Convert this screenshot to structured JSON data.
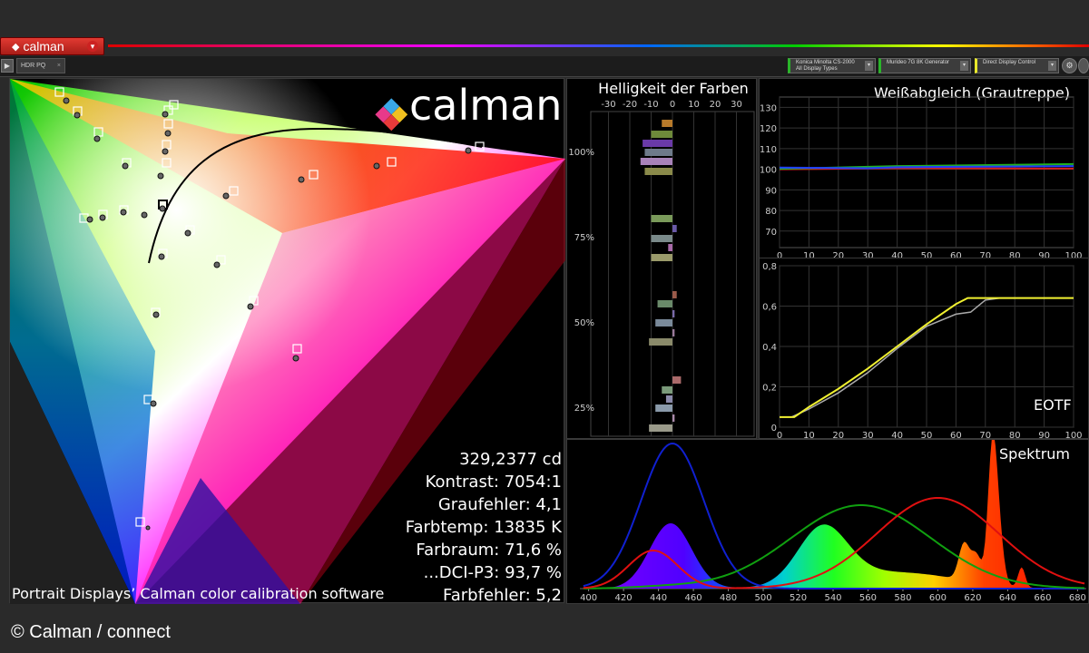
{
  "app": {
    "logo_text": "calman"
  },
  "toolbar": {
    "tab_label": "HDR PQ",
    "devices": [
      {
        "line1": "Konica Minolta CS-2000",
        "line2": "All Display Types",
        "color": "#2ab52a"
      },
      {
        "line1": "Murideo 7G 8K Generator",
        "line2": "",
        "color": "#2ab52a"
      },
      {
        "line1": "Direct Display Control",
        "line2": "",
        "color": "#e8e82a"
      }
    ]
  },
  "cie": {
    "brand": "calman",
    "caption": "Portrait Displays’ Calman color calibration software",
    "stats": [
      "329,2377 cd",
      "Kontrast: 7054:1",
      "Graufehler: 4,1",
      "Farbtemp: 13835 K",
      "Farbraum: 71,6 %",
      "...DCI-P3: 93,7 %",
      "Farbfehler: 5,2"
    ]
  },
  "helligkeit": {
    "title": "Helligkeit der Farben",
    "x_ticks": [
      "-30",
      "-20",
      "-10",
      "0",
      "10",
      "20",
      "30"
    ],
    "y_labels": [
      "100%",
      "75%",
      "50%",
      "25%"
    ],
    "bars": [
      {
        "value": -5,
        "color": "#b87a2a"
      },
      {
        "value": -10,
        "color": "#6e8a3a"
      },
      {
        "value": -14,
        "color": "#6a3aa8"
      },
      {
        "value": -13,
        "color": "#6e7a8a"
      },
      {
        "value": -15,
        "color": "#a882b8"
      },
      {
        "value": -13,
        "color": "#8a8a4a"
      },
      {
        "value": -10,
        "color": "#7a9a5a"
      },
      {
        "value": 2,
        "color": "#6a5aa8"
      },
      {
        "value": -10,
        "color": "#7a8a8a"
      },
      {
        "value": -2,
        "color": "#a86aa8"
      },
      {
        "value": -10,
        "color": "#9a9a6a"
      },
      {
        "value": 2,
        "color": "#9a5a4a"
      },
      {
        "value": -7,
        "color": "#6a8a6a"
      },
      {
        "value": 1,
        "color": "#7a6aa8"
      },
      {
        "value": -8,
        "color": "#7a8a9a"
      },
      {
        "value": 1,
        "color": "#9a7a9a"
      },
      {
        "value": -11,
        "color": "#8a8a6a"
      },
      {
        "value": 4,
        "color": "#aa6a6a"
      },
      {
        "value": -5,
        "color": "#7a9a7a"
      },
      {
        "value": -3,
        "color": "#8a8aaa"
      },
      {
        "value": -8,
        "color": "#8a9aaa"
      },
      {
        "value": 1,
        "color": "#aa8aaa"
      },
      {
        "value": -11,
        "color": "#9a9a8a"
      }
    ]
  },
  "weiss": {
    "title": "Weißabgleich (Grautreppe)",
    "y_ticks": [
      "130",
      "120",
      "110",
      "100",
      "90",
      "80",
      "70"
    ],
    "x_ticks": [
      "0",
      "10",
      "20",
      "30",
      "40",
      "50",
      "60",
      "70",
      "80",
      "90",
      "100"
    ],
    "red": [
      [
        0,
        100
      ],
      [
        40,
        100.5
      ],
      [
        100,
        100.3
      ]
    ],
    "green": [
      [
        0,
        100.2
      ],
      [
        40,
        101.5
      ],
      [
        100,
        102.5
      ]
    ],
    "blue": [
      [
        0,
        100.8
      ],
      [
        30,
        100.5
      ],
      [
        40,
        101
      ],
      [
        100,
        101.5
      ]
    ]
  },
  "eotf": {
    "title": "EOTF",
    "y_ticks": [
      "0,8",
      "0,6",
      "0,4",
      "0,2",
      "0"
    ],
    "x_ticks": [
      "0",
      "10",
      "20",
      "30",
      "40",
      "50",
      "60",
      "70",
      "80",
      "90",
      "100"
    ],
    "target": [
      [
        0,
        0.05
      ],
      [
        5,
        0.05
      ],
      [
        10,
        0.1
      ],
      [
        20,
        0.19
      ],
      [
        30,
        0.29
      ],
      [
        40,
        0.4
      ],
      [
        50,
        0.51
      ],
      [
        60,
        0.61
      ],
      [
        64,
        0.64
      ],
      [
        100,
        0.64
      ]
    ],
    "measured": [
      [
        0,
        0.05
      ],
      [
        4,
        0.05
      ],
      [
        10,
        0.09
      ],
      [
        20,
        0.17
      ],
      [
        30,
        0.27
      ],
      [
        40,
        0.39
      ],
      [
        50,
        0.5
      ],
      [
        60,
        0.56
      ],
      [
        65,
        0.57
      ],
      [
        70,
        0.63
      ],
      [
        75,
        0.64
      ],
      [
        100,
        0.64
      ]
    ]
  },
  "spektrum": {
    "title": "Spektrum",
    "x_ticks": [
      "400",
      "420",
      "440",
      "460",
      "480",
      "500",
      "520",
      "540",
      "560",
      "580",
      "600",
      "620",
      "640",
      "660",
      "680"
    ]
  },
  "footer": {
    "credit": "© Calman / connect"
  }
}
